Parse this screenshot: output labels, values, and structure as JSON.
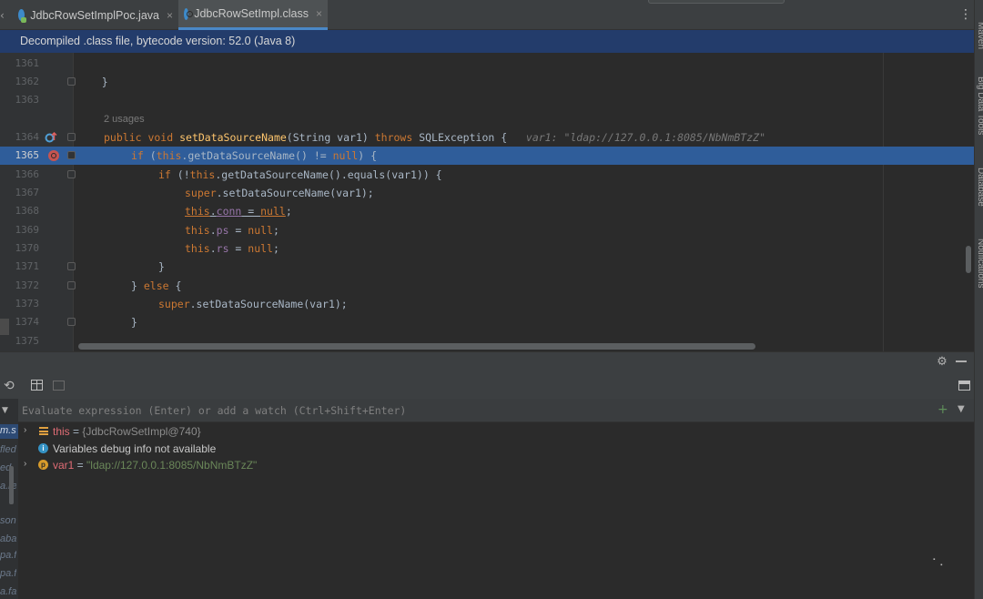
{
  "tabs": [
    {
      "label": "JdbcRowSetImplPoc.java",
      "close": "×"
    },
    {
      "label": "JdbcRowSetImpl.class",
      "close": "×"
    }
  ],
  "tab_more_icon": "⋮",
  "banner": "Decompiled .class file, bytecode version: 52.0 (Java 8)",
  "editor": {
    "lines": [
      {
        "num": "1361"
      },
      {
        "num": "1362",
        "code": "    }"
      },
      {
        "num": "1363"
      },
      {
        "num": "",
        "usages": "2 usages"
      },
      {
        "num": "1364",
        "code_sig": "public void setDataSourceName(String var1) throws SQLException {",
        "hint": "var1: \"ldap://127.0.0.1:8085/NbNmBTzZ\""
      },
      {
        "num": "1365",
        "code": "if (this.getDataSourceName() != null) {"
      },
      {
        "num": "1366",
        "code": "if (!this.getDataSourceName().equals(var1)) {"
      },
      {
        "num": "1367",
        "code": "super.setDataSourceName(var1);"
      },
      {
        "num": "1368",
        "code": "this.conn = null;"
      },
      {
        "num": "1369",
        "code": "this.ps = null;"
      },
      {
        "num": "1370",
        "code": "this.rs = null;"
      },
      {
        "num": "1371",
        "code": "}"
      },
      {
        "num": "1372",
        "code": "} else {"
      },
      {
        "num": "1373",
        "code": "super.setDataSourceName(var1);"
      },
      {
        "num": "1374",
        "code": "}"
      },
      {
        "num": "1375"
      }
    ]
  },
  "right_tools": [
    "Maven",
    "Big Data Tools",
    "Database",
    "Notifications"
  ],
  "debug": {
    "evaluate_placeholder": "Evaluate expression (Enter) or add a watch (Ctrl+Shift+Enter)",
    "add_icon": "+",
    "variables": [
      {
        "name": "this",
        "eq": " = ",
        "value": "{JdbcRowSetImpl@740}"
      },
      {
        "message": "Variables debug info not available"
      },
      {
        "name": "var1",
        "eq": " = ",
        "value": "\"ldap://127.0.0.1:8085/NbNmBTzZ\""
      }
    ]
  },
  "left_panel_fragments": [
    "m.s",
    "fled",
    "ed",
    "a.re",
    "son",
    "aba",
    "pa.f",
    "pa.f",
    "a.fa"
  ],
  "colors": {
    "accent": "#2f5d9a",
    "banner": "#233c6b",
    "keyword": "#cc7832",
    "method": "#ffc66d",
    "field": "#9876aa",
    "string": "#6a8759"
  }
}
